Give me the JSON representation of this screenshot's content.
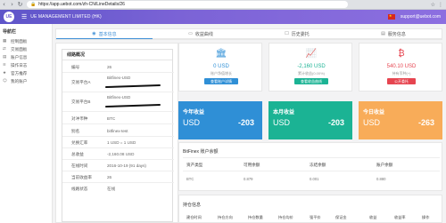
{
  "browser": {
    "url": "https://app.uebot.com/zh-CN/LineDetails/26"
  },
  "app": {
    "logo_text": "UE",
    "title": "UE MANAGEMENT LIMITED (HK)",
    "email": "support@uebot.com"
  },
  "sidebar": {
    "heading": "导航栏",
    "items": [
      {
        "label": "控制面板",
        "icon": "dashboard-icon"
      },
      {
        "label": "交易面板",
        "icon": "trade-icon"
      },
      {
        "label": "账户信息",
        "icon": "account-icon"
      },
      {
        "label": "操作日志",
        "icon": "log-icon"
      },
      {
        "label": "官方推荐",
        "icon": "recommend-icon"
      },
      {
        "label": "我的账户",
        "icon": "user-icon"
      }
    ]
  },
  "tabs": [
    {
      "label": "基本信息",
      "icon": "info-icon",
      "active": true
    },
    {
      "label": "收益曲线",
      "icon": "chart-icon",
      "active": false
    },
    {
      "label": "历史委托",
      "icon": "history-icon",
      "active": false
    },
    {
      "label": "服务信息",
      "icon": "service-icon",
      "active": false
    }
  ],
  "overview": {
    "title": "线路概况",
    "rows": [
      {
        "key": "编号",
        "value": "26"
      },
      {
        "key": "交易平台A",
        "value": "Bitfinex-USD",
        "redacted": true
      },
      {
        "key": "交易平台B",
        "value": "Bitfinex-USD",
        "redacted": true
      },
      {
        "key": "对冲币种",
        "value": "BTC"
      },
      {
        "key": "别名",
        "value": "bitfinex-test"
      },
      {
        "key": "兑换汇率",
        "value": "1 USD = 1 USD"
      },
      {
        "key": "总收益",
        "value": "-2,160.08 USD"
      },
      {
        "key": "在线时间",
        "value": "2016-10-19 (91 days)"
      },
      {
        "key": "当前收益率",
        "value": "26"
      },
      {
        "key": "线路状态",
        "value": "在线"
      }
    ]
  },
  "stats": [
    {
      "icon": "bank-icon",
      "value": "0 USD",
      "sub": "账户净值增长",
      "button": "查看账户详情",
      "color": "#2f8fd6"
    },
    {
      "icon": "chart-line-icon",
      "value": "-2,160 USD",
      "sub": "累计收益(0.00%)",
      "button": "查看收益曲线",
      "color": "#1bb394"
    },
    {
      "icon": "bitcoin-icon",
      "value": "540.10 USD",
      "sub": "持有币种(+)",
      "button": "公开委托",
      "color": "#e64550"
    }
  ],
  "big_stats": [
    {
      "label": "今年收益",
      "currency": "USD",
      "value": "-203",
      "color": "#2f8fd6"
    },
    {
      "label": "本月收益",
      "currency": "USD",
      "value": "-203",
      "color": "#1bb394"
    },
    {
      "label": "今日收益",
      "currency": "USD",
      "value": "-263",
      "color": "#f8ac59"
    }
  ],
  "balance": {
    "title": "BitFinex 账户余额",
    "headers": [
      "资产类型",
      "可用余额",
      "冻结余额",
      "账户余额"
    ],
    "rows": [
      [
        "BTC",
        "0.879",
        "0.001",
        "0.880"
      ]
    ]
  },
  "trades": {
    "title": "持仓信息",
    "headers": [
      "建仓时间",
      "持仓方向",
      "持仓数量",
      "持仓均价",
      "强平价",
      "保证金",
      "收益",
      "收益率",
      "操作"
    ]
  }
}
